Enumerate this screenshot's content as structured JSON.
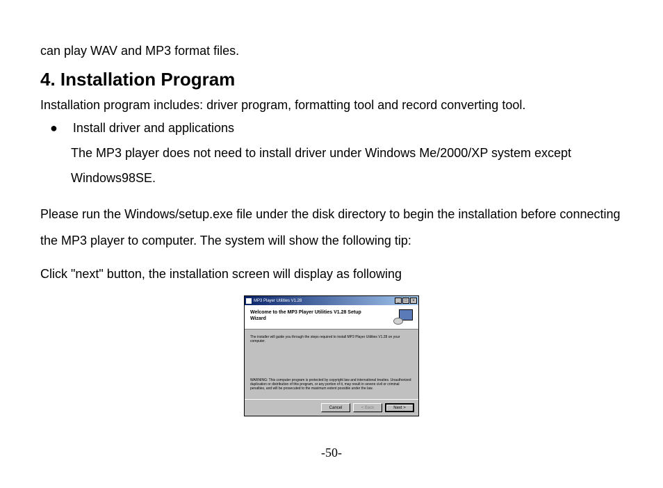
{
  "doc": {
    "intro_line": "can play WAV and MP3 format files.",
    "heading": "4. Installation Program",
    "desc": "Installation program includes: driver program, formatting tool and record converting tool.",
    "bullet_label": "Install driver and applications",
    "bullet_body": "The MP3 player does not need to install driver under Windows Me/2000/XP system except Windows98SE.",
    "para1": "Please run the Windows/setup.exe file under the disk directory to begin the installation before connecting the MP3 player to computer. The system will show the following tip:",
    "para2": "Click \"next\" button, the installation screen will display as following",
    "page_number": "-50-"
  },
  "installer": {
    "titlebar_text": "MP3 Player Utilities V1.28",
    "header_text": "Welcome to the MP3 Player Utilities V1.28 Setup Wizard",
    "body_top": "The installer will guide you through the steps required to install MP3 Player Utilities V1.28 on your computer.",
    "body_warning": "WARNING: This computer program is protected by copyright law and international treaties. Unauthorized duplication or distribution of this program, or any portion of it, may result in severe civil or criminal penalties, and will be prosecuted to the maximum extent possible under the law.",
    "buttons": {
      "cancel": "Cancel",
      "back": "< Back",
      "next": "Next >"
    },
    "titlebar_controls": {
      "minimize": "_",
      "maximize": "□",
      "close": "×"
    }
  }
}
